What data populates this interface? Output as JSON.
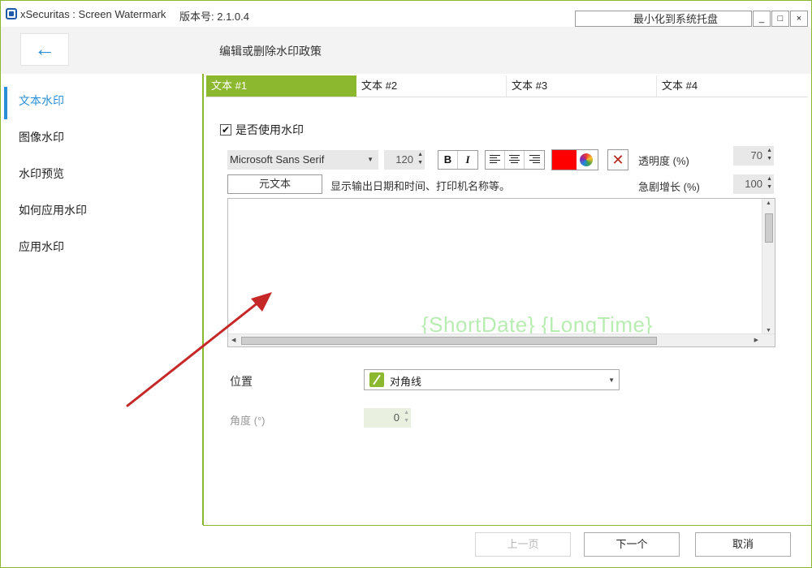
{
  "titlebar": {
    "app_title": "xSecuritas : Screen Watermark",
    "version": "版本号: 2.1.0.4",
    "tray_button": "最小化到系统托盘",
    "minimize_glyph": "_",
    "maximize_glyph": "□",
    "close_glyph": "×"
  },
  "header": {
    "back_glyph": "←",
    "page_heading": "编辑或删除水印政策"
  },
  "sidebar": {
    "items": [
      {
        "label": "文本水印",
        "active": true
      },
      {
        "label": "图像水印",
        "active": false
      },
      {
        "label": "水印预览",
        "active": false
      },
      {
        "label": "如何应用水印",
        "active": false
      },
      {
        "label": "应用水印",
        "active": false
      }
    ]
  },
  "tabs": [
    {
      "label": "文本 #1",
      "active": true
    },
    {
      "label": "文本 #2",
      "active": false
    },
    {
      "label": "文本 #3",
      "active": false
    },
    {
      "label": "文本 #4",
      "active": false
    }
  ],
  "form": {
    "use_watermark_label": "是否使用水印",
    "use_watermark_checked": true,
    "font_family": "Microsoft Sans Serif",
    "font_size": "120",
    "bold_glyph": "B",
    "italic_glyph": "I",
    "text_color": "#ff0000",
    "clear_glyph": "✕",
    "opacity_label": "透明度 (%)",
    "opacity_value": "70",
    "meta_button": "元文本",
    "meta_description": "显示输出日期和时间、打印机名称等。",
    "boost_label": "急剧增长 (%)",
    "boost_value": "100",
    "watermark_text": "{ShortDate}  {LongTime}",
    "position_label": "位置",
    "position_value": "对角线",
    "angle_label": "角度 (°)",
    "angle_value": "0"
  },
  "footer": {
    "prev_label": "上一页",
    "next_label": "下一个",
    "cancel_label": "取消"
  },
  "colors": {
    "accent_green": "#8bb82e",
    "accent_blue": "#2a8fd6",
    "annotation_arrow": "#c62828"
  }
}
